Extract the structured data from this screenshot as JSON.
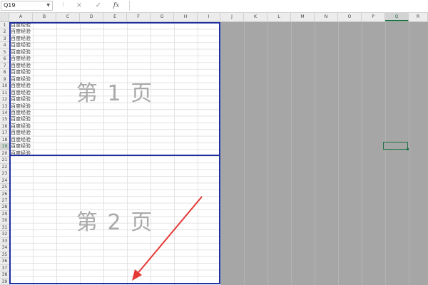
{
  "formula_bar": {
    "name_box": "Q19",
    "cancel_icon": "×",
    "enter_icon": "✓",
    "fx_label": "fx",
    "formula_value": ""
  },
  "columns": [
    "A",
    "B",
    "C",
    "D",
    "E",
    "F",
    "G",
    "H",
    "I",
    "J",
    "K",
    "L",
    "M",
    "N",
    "O",
    "P",
    "Q",
    "R"
  ],
  "selected_column": "Q",
  "rows": [
    "1",
    "2",
    "3",
    "4",
    "5",
    "6",
    "7",
    "8",
    "9",
    "10",
    "11",
    "12",
    "13",
    "14",
    "15",
    "16",
    "17",
    "18",
    "19",
    "20",
    "21",
    "22",
    "23",
    "24",
    "25",
    "26",
    "27",
    "28",
    "29",
    "30",
    "31",
    "32",
    "33",
    "34",
    "35",
    "36",
    "37",
    "38",
    "39"
  ],
  "selected_row": "19",
  "cells_A": [
    "百度经验",
    "百度经验",
    "百度经验",
    "百度经验",
    "百度经验",
    "百度经验",
    "百度经验",
    "百度经验",
    "百度经验",
    "百度经验",
    "百度经验",
    "百度经验",
    "百度经验",
    "百度经验",
    "百度经验",
    "百度经验",
    "百度经验",
    "百度经验",
    "百度经验",
    "百度经验"
  ],
  "page_labels": {
    "page1": "第 1 页",
    "page2": "第 2 页"
  },
  "colors": {
    "page_border": "#1e2fa0",
    "arrow": "#e53935",
    "selection": "#217346",
    "outside_print_area": "#a6a6a6"
  }
}
